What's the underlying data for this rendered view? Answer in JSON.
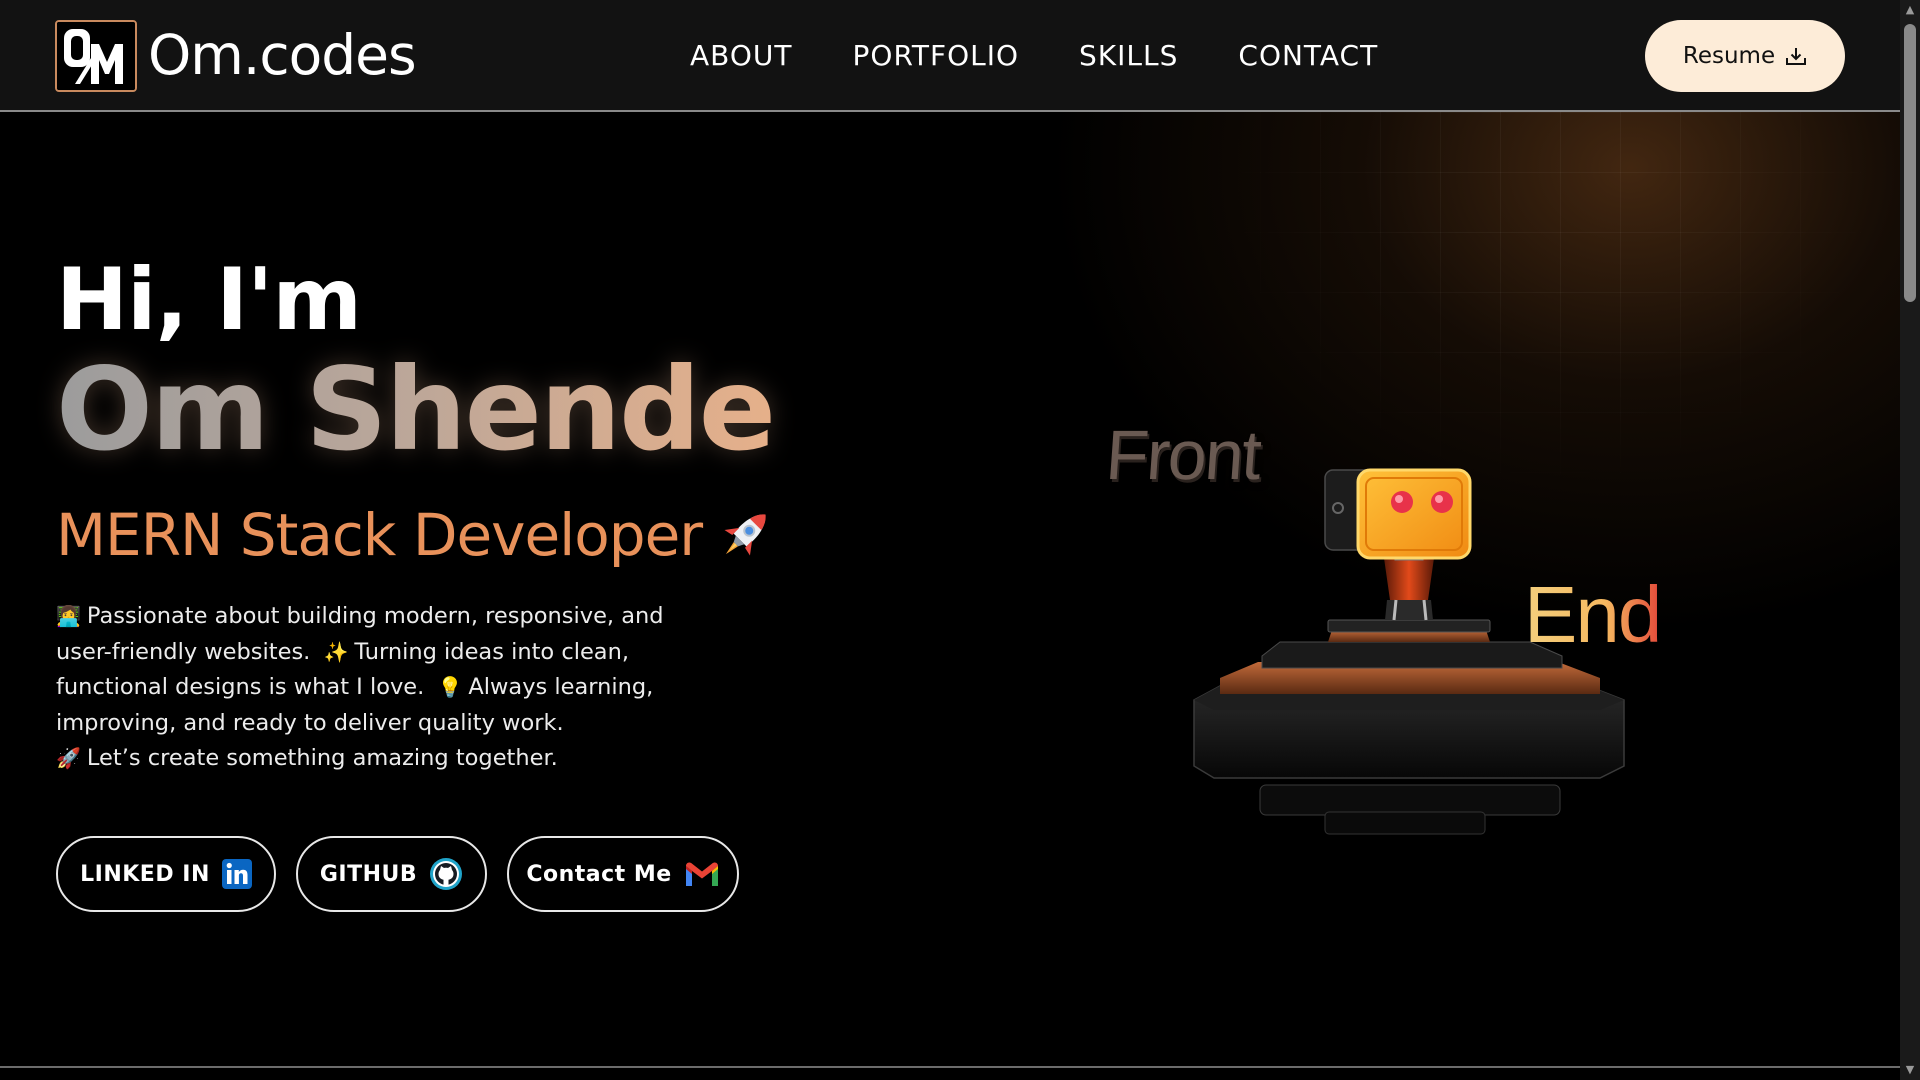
{
  "header": {
    "brand": "Om.codes",
    "logo_text": "OM",
    "nav": {
      "about": "ABOUT",
      "portfolio": "PORTFOLIO",
      "skills": "SKILLS",
      "contact": "CONTACT"
    },
    "resume_label": "Resume",
    "resume_icon": "download-icon"
  },
  "hero": {
    "greeting": "Hi, I'm",
    "name": "Om Shende",
    "role": "MERN Stack Developer",
    "role_icon": "rocket-icon",
    "bio": [
      {
        "icon": "👩‍💻",
        "text": "Passionate about building modern, responsive, and user-friendly websites."
      },
      {
        "icon": "✨",
        "text": "Turning ideas into clean, functional designs is what I love."
      },
      {
        "icon": "💡",
        "text": "Always learning, improving, and ready to deliver quality work."
      },
      {
        "icon": "🚀",
        "text": "Let’s create something amazing together."
      }
    ],
    "buttons": {
      "linkedin": "LINKED IN",
      "github": "GITHUB",
      "contact": "Contact Me"
    }
  },
  "illustration": {
    "front_word": "Front",
    "end_word": "End"
  },
  "colors": {
    "accent": "#e8915a",
    "resume_bg": "#fdecd8",
    "nav_bg": "#121212",
    "page_bg": "#000000",
    "linkedin": "#0a66c2",
    "github_ring": "#1fa3c9"
  }
}
